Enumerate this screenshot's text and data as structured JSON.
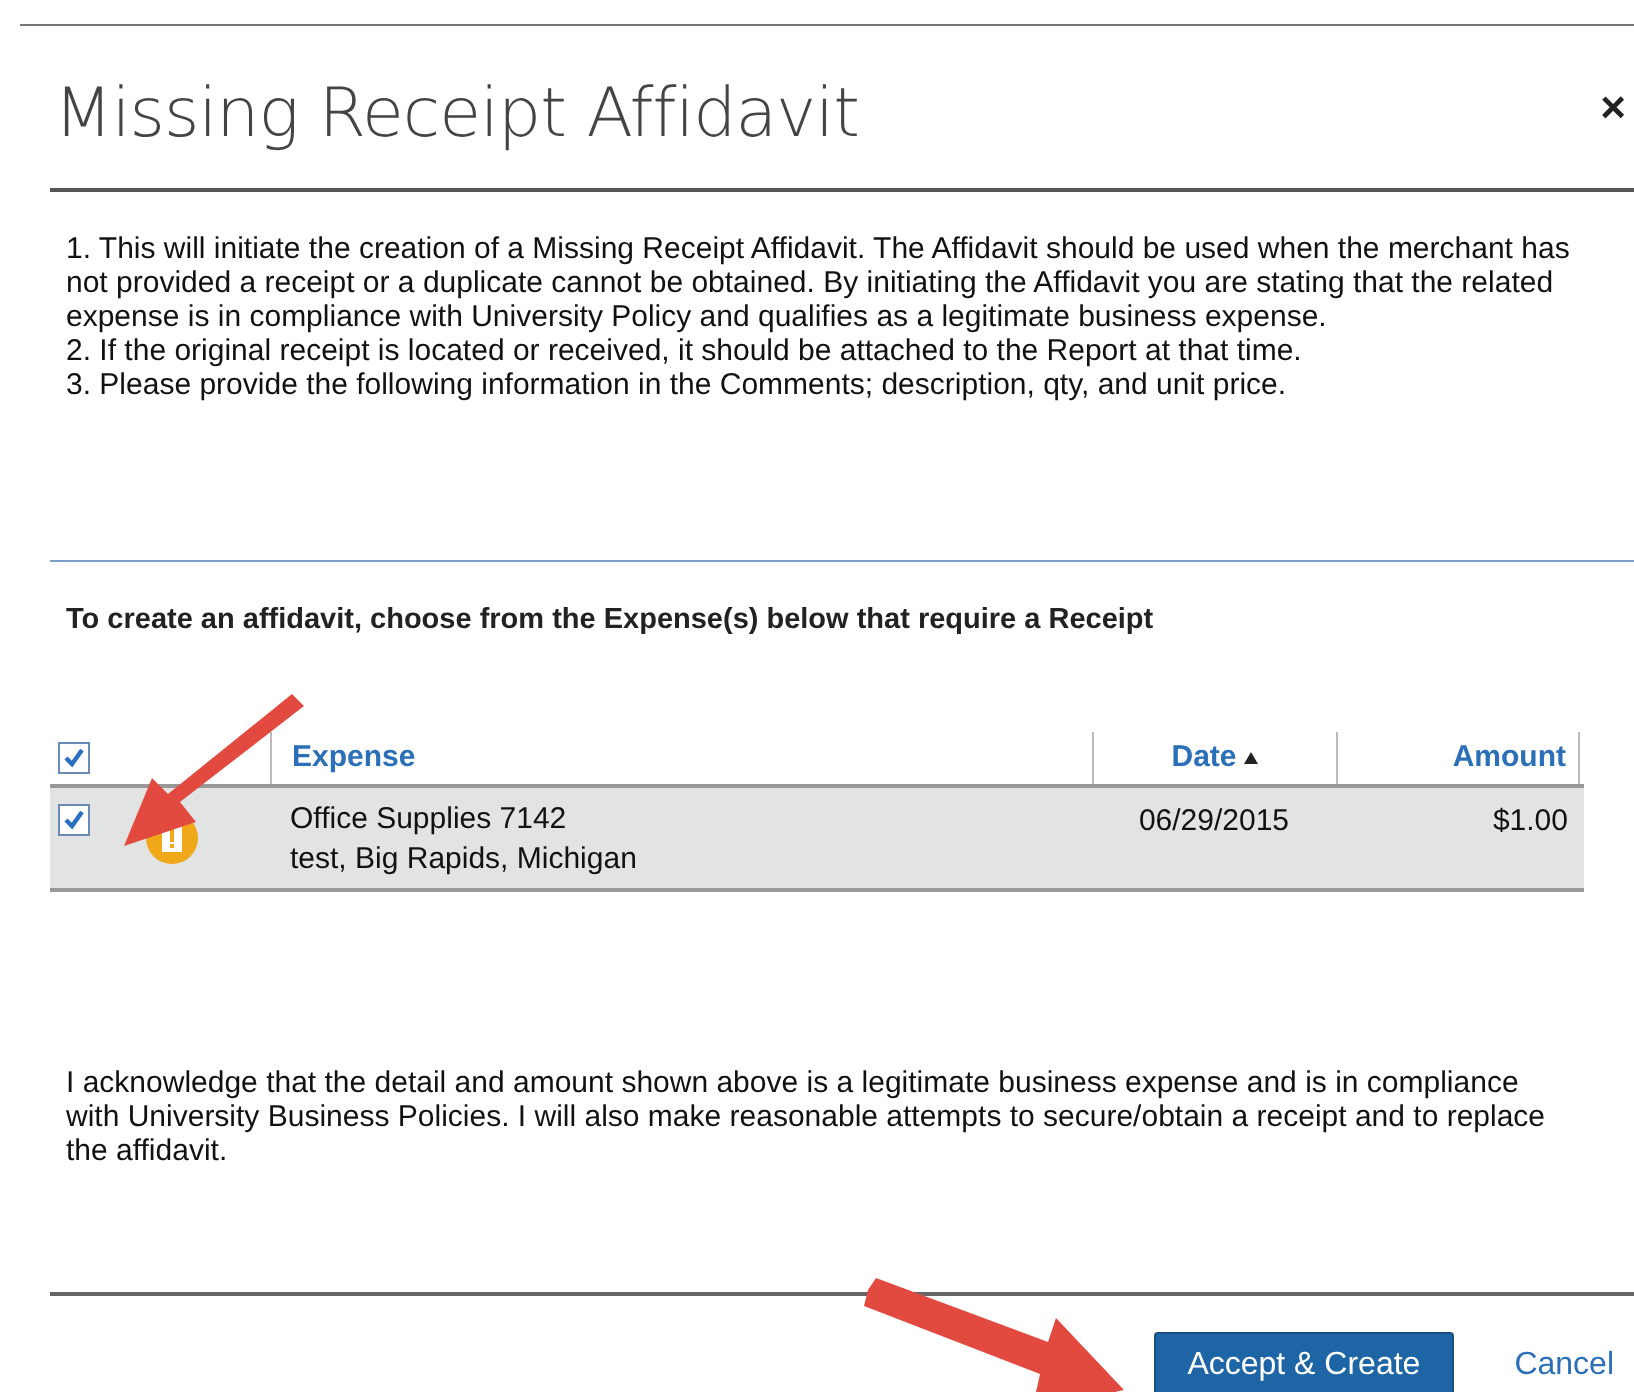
{
  "dialog": {
    "title": "Missing Receipt Affidavit",
    "close": "×"
  },
  "instructions": [
    "1. This will initiate the creation of a Missing Receipt Affidavit. The Affidavit should be used when the merchant has not provided a receipt or a duplicate cannot be obtained. By initiating the Affidavit you are stating that the related expense is in compliance with University Policy and qualifies as a legitimate business expense.",
    "2. If the original receipt is located or received, it should be attached to the Report at that time.",
    "3. Please provide the following information in the Comments; description, qty, and unit price."
  ],
  "table_heading": "To create an affidavit, choose from the Expense(s) below that require a Receipt",
  "table": {
    "select_all_checked": true,
    "columns": [
      {
        "label": "Expense",
        "sorted": false
      },
      {
        "label": "Date",
        "sorted": true
      },
      {
        "label": "Amount",
        "sorted": false
      }
    ],
    "rows": [
      {
        "checked": true,
        "warning": true,
        "expense": "Office Supplies 7142",
        "location": "test, Big Rapids, Michigan",
        "date": "06/29/2015",
        "amount": "$1.00"
      }
    ]
  },
  "acknowledgement": "I acknowledge that the detail and amount shown above is a legitimate business expense and is in compliance with University Business Policies. I will also make reasonable attempts to secure/obtain a receipt and to replace the affidavit.",
  "buttons": [
    {
      "label": "Accept & Create",
      "kind": "primary"
    },
    {
      "label": "Cancel",
      "kind": "link"
    }
  ]
}
